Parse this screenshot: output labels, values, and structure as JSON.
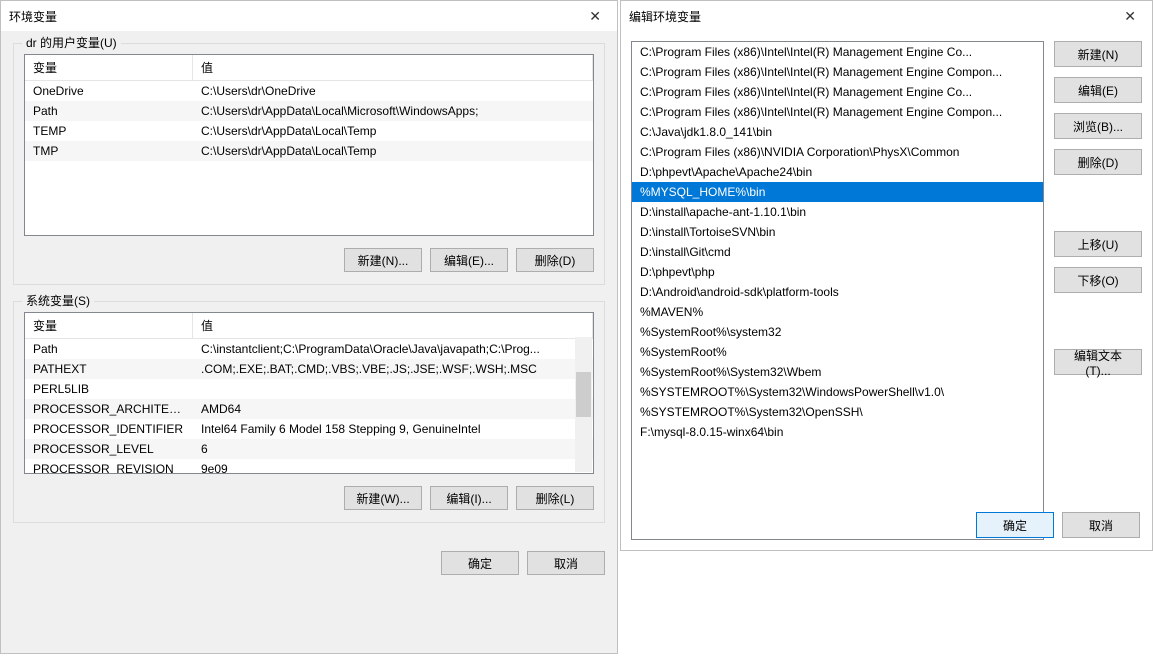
{
  "left": {
    "title": "环境变量",
    "user_group_legend": "dr 的用户变量(U)",
    "sys_group_legend": "系统变量(S)",
    "col_var": "变量",
    "col_val": "值",
    "user_vars": [
      {
        "name": "OneDrive",
        "value": "C:\\Users\\dr\\OneDrive"
      },
      {
        "name": "Path",
        "value": "C:\\Users\\dr\\AppData\\Local\\Microsoft\\WindowsApps;"
      },
      {
        "name": "TEMP",
        "value": "C:\\Users\\dr\\AppData\\Local\\Temp"
      },
      {
        "name": "TMP",
        "value": "C:\\Users\\dr\\AppData\\Local\\Temp"
      }
    ],
    "sys_vars": [
      {
        "name": "Path",
        "value": "C:\\instantclient;C:\\ProgramData\\Oracle\\Java\\javapath;C:\\Prog..."
      },
      {
        "name": "PATHEXT",
        "value": ".COM;.EXE;.BAT;.CMD;.VBS;.VBE;.JS;.JSE;.WSF;.WSH;.MSC"
      },
      {
        "name": "PERL5LIB",
        "value": ""
      },
      {
        "name": "PROCESSOR_ARCHITECT...",
        "value": "AMD64"
      },
      {
        "name": "PROCESSOR_IDENTIFIER",
        "value": "Intel64 Family 6 Model 158 Stepping 9, GenuineIntel"
      },
      {
        "name": "PROCESSOR_LEVEL",
        "value": "6"
      },
      {
        "name": "PROCESSOR_REVISION",
        "value": "9e09"
      }
    ],
    "buttons": {
      "user_new": "新建(N)...",
      "user_edit": "编辑(E)...",
      "user_del": "删除(D)",
      "sys_new": "新建(W)...",
      "sys_edit": "编辑(I)...",
      "sys_del": "删除(L)",
      "ok": "确定",
      "cancel": "取消"
    }
  },
  "right": {
    "title": "编辑环境变量",
    "items": [
      "C:\\Program Files (x86)\\Intel\\Intel(R) Management Engine Co...",
      "C:\\Program Files (x86)\\Intel\\Intel(R) Management Engine Compon...",
      "C:\\Program Files (x86)\\Intel\\Intel(R) Management Engine Co...",
      "C:\\Program Files (x86)\\Intel\\Intel(R) Management Engine Compon...",
      "C:\\Java\\jdk1.8.0_141\\bin",
      "C:\\Program Files (x86)\\NVIDIA Corporation\\PhysX\\Common",
      "D:\\phpevt\\Apache\\Apache24\\bin",
      "%MYSQL_HOME%\\bin",
      "D:\\install\\apache-ant-1.10.1\\bin",
      "D:\\install\\TortoiseSVN\\bin",
      "D:\\install\\Git\\cmd",
      "D:\\phpevt\\php",
      "D:\\Android\\android-sdk\\platform-tools",
      "%MAVEN%",
      "%SystemRoot%\\system32",
      "%SystemRoot%",
      "%SystemRoot%\\System32\\Wbem",
      "%SYSTEMROOT%\\System32\\WindowsPowerShell\\v1.0\\",
      "%SYSTEMROOT%\\System32\\OpenSSH\\",
      "F:\\mysql-8.0.15-winx64\\bin"
    ],
    "selected_index": 7,
    "buttons": {
      "new": "新建(N)",
      "edit": "编辑(E)",
      "browse": "浏览(B)...",
      "del": "删除(D)",
      "up": "上移(U)",
      "down": "下移(O)",
      "edit_text": "编辑文本(T)...",
      "ok": "确定",
      "cancel": "取消"
    }
  }
}
